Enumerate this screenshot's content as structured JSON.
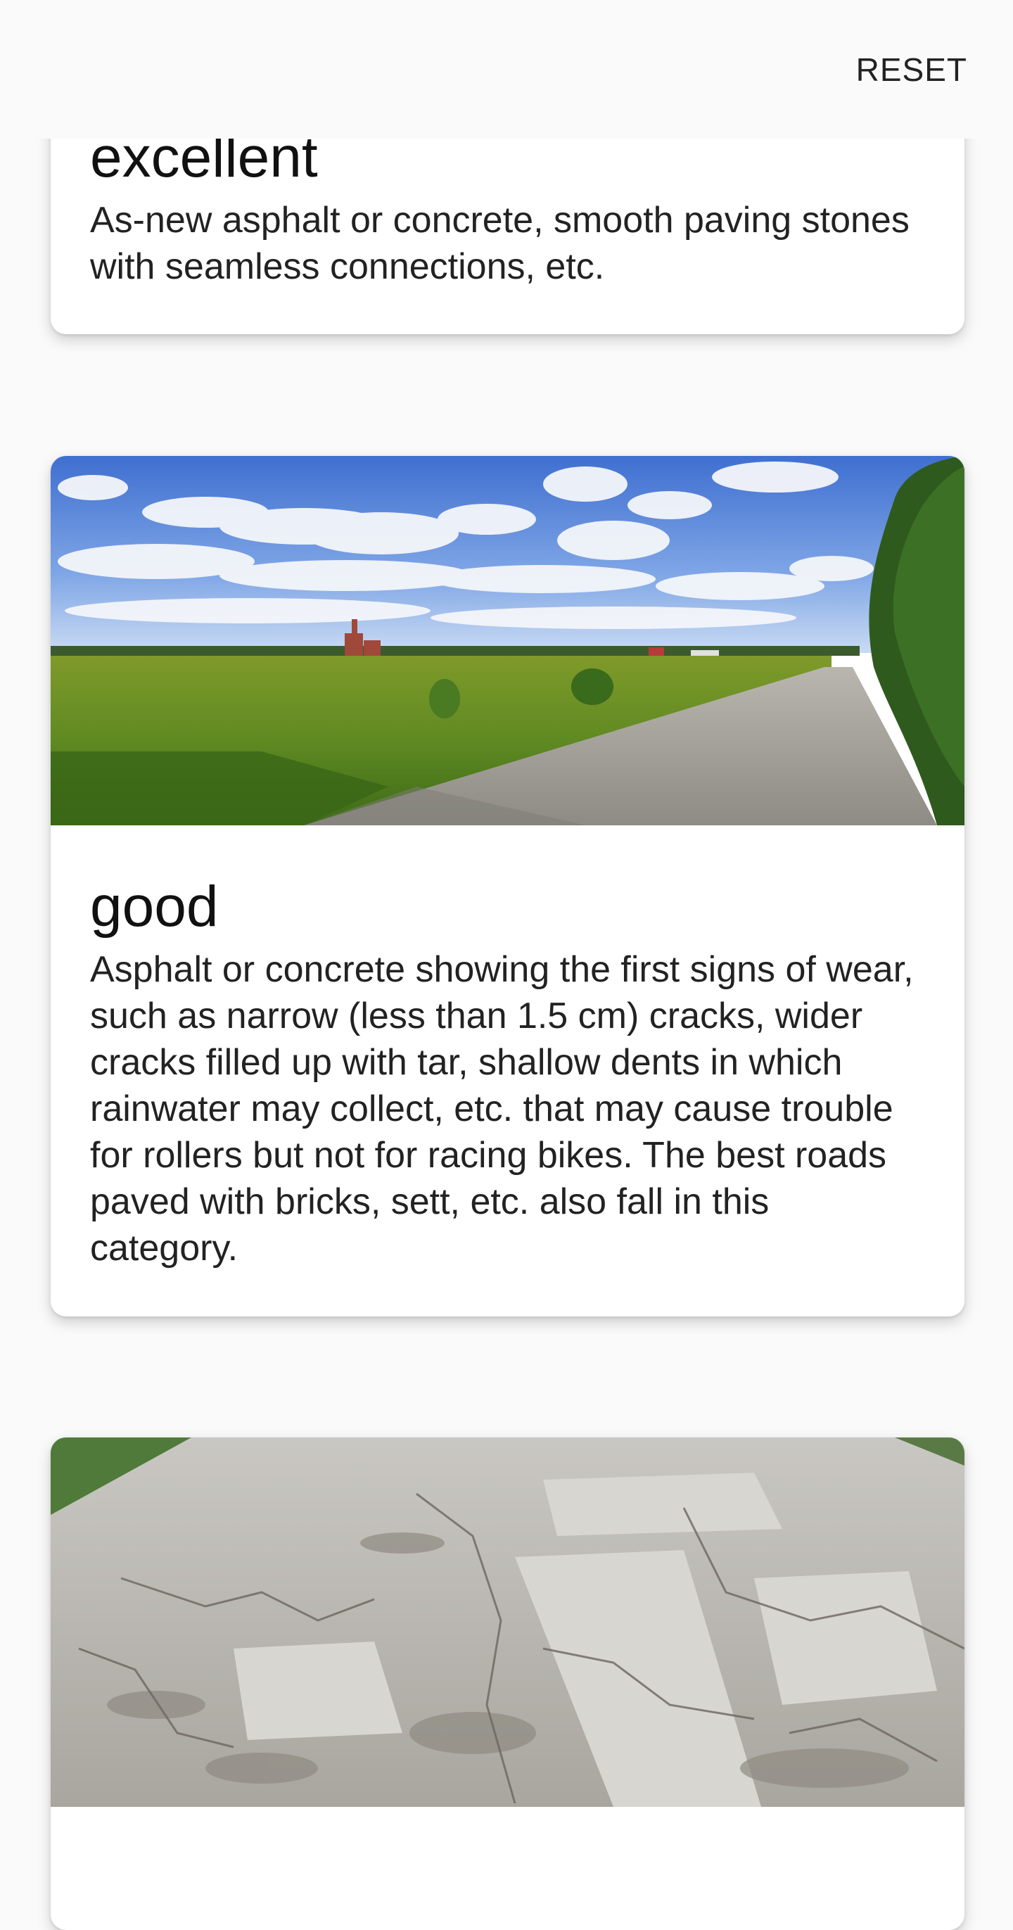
{
  "app_bar": {
    "reset_label": "RESET"
  },
  "cards": [
    {
      "title": "excellent",
      "description": "As-new asphalt or concrete, smooth paving stones with seamless connections, etc."
    },
    {
      "title": "good",
      "description": "Asphalt or concrete showing the first signs of wear, such as narrow (less than 1.5 cm) cracks, wider cracks filled up with tar, shallow dents in which rainwater may collect, etc. that may cause trouble for rollers but not for racing bikes. The best roads paved with bricks, sett, etc. also fall in this category.",
      "image": "road-in-field-photo"
    },
    {
      "image": "cracked-asphalt-photo"
    }
  ],
  "colors": {
    "background": "#fafafa",
    "card": "#ffffff",
    "text": "#222222"
  }
}
